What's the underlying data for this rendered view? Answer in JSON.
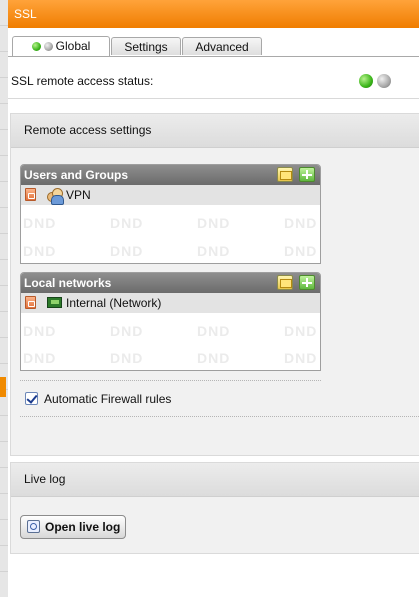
{
  "header": {
    "title": "SSL"
  },
  "tabs": [
    {
      "label": "Global"
    },
    {
      "label": "Settings"
    },
    {
      "label": "Advanced"
    }
  ],
  "status": {
    "label": "SSL remote access status:"
  },
  "remote_access": {
    "title": "Remote access settings",
    "users_and_groups": {
      "title": "Users and Groups",
      "items": [
        "VPN"
      ]
    },
    "local_networks": {
      "title": "Local networks",
      "items": [
        "Internal (Network)"
      ]
    },
    "dnd_placeholder": "DND",
    "automatic_firewall_rules": {
      "label": "Automatic Firewall rules",
      "checked": true
    }
  },
  "live_log": {
    "title": "Live log",
    "button_label": "Open live log"
  },
  "colors": {
    "header": "#f28a10",
    "status_on": "#3bb51a",
    "status_off": "#a8a8a8"
  }
}
